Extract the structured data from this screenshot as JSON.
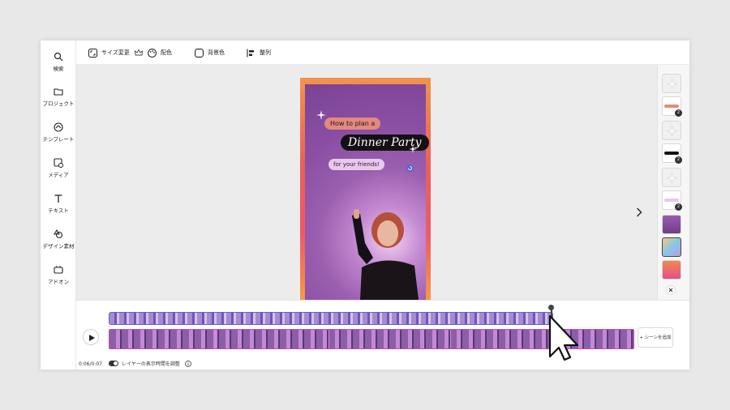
{
  "sidebar": {
    "items": [
      {
        "label": "検索",
        "icon": "search-icon"
      },
      {
        "label": "プロジェクト",
        "icon": "folder-icon"
      },
      {
        "label": "テンプレート",
        "icon": "template-icon"
      },
      {
        "label": "メディア",
        "icon": "media-icon"
      },
      {
        "label": "テキスト",
        "icon": "text-icon"
      },
      {
        "label": "デザイン素材",
        "icon": "shapes-icon"
      },
      {
        "label": "アドオン",
        "icon": "addon-icon"
      }
    ]
  },
  "toolbar": {
    "resize_label": "サイズ変更",
    "color_label": "配色",
    "bg_label": "背景色",
    "align_label": "整列"
  },
  "poster": {
    "line1": "How to plan a",
    "line2": "Dinner Party",
    "line3": "for your friends!"
  },
  "timeline": {
    "time": "0:06/0:07",
    "toggle_label": "レイヤーの表示時間を調整",
    "add_scene_label": "+ シーンを追加"
  },
  "right_panel": {
    "badges": [
      "2",
      "2",
      "2"
    ]
  },
  "colors": {
    "accent": "#5b63d3",
    "scene_border": "#c04ebb"
  }
}
